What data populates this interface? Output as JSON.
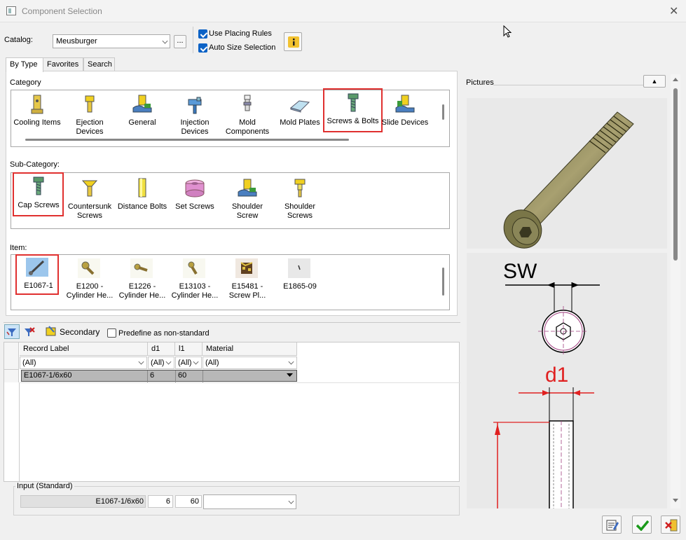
{
  "window": {
    "title": "Component Selection",
    "close_glyph": "✕"
  },
  "catalog": {
    "label": "Catalog:",
    "value": "Meusburger",
    "browse_label": "..."
  },
  "options": {
    "use_placing_rules": {
      "label": "Use Placing Rules",
      "checked": true
    },
    "auto_size_selection": {
      "label": "Auto Size Selection",
      "checked": true
    },
    "info_label": "i"
  },
  "tabs": [
    {
      "label": "By Type",
      "active": true
    },
    {
      "label": "Favorites",
      "active": false
    },
    {
      "label": "Search",
      "active": false
    }
  ],
  "category": {
    "label": "Category",
    "items": [
      {
        "label": "Cooling Items",
        "icon": "cooling-items-icon"
      },
      {
        "label": "Ejection Devices",
        "icon": "ejection-devices-icon"
      },
      {
        "label": "General",
        "icon": "general-icon"
      },
      {
        "label": "Injection Devices",
        "icon": "injection-devices-icon"
      },
      {
        "label": "Mold Components",
        "icon": "mold-components-icon"
      },
      {
        "label": "Mold Plates",
        "icon": "mold-plates-icon"
      },
      {
        "label": "Screws & Bolts",
        "icon": "screws-bolts-icon",
        "selected": true
      },
      {
        "label": "Slide Devices",
        "icon": "slide-devices-icon"
      }
    ]
  },
  "sub_category": {
    "label": "Sub-Category:",
    "items": [
      {
        "label": "Cap Screws",
        "icon": "cap-screws-icon",
        "selected": true
      },
      {
        "label": "Countersunk Screws",
        "icon": "countersunk-screws-icon"
      },
      {
        "label": "Distance Bolts",
        "icon": "distance-bolts-icon"
      },
      {
        "label": "Set Screws",
        "icon": "set-screws-icon"
      },
      {
        "label": "Shoulder Screw",
        "icon": "shoulder-screw-icon"
      },
      {
        "label": "Shoulder Screws",
        "icon": "shoulder-screws-icon"
      }
    ]
  },
  "item": {
    "label": "Item:",
    "items": [
      {
        "label": "E1067-1",
        "icon": "e1067-1-thumbnail",
        "selected": true
      },
      {
        "label": "E1200 - Cylinder He...",
        "icon": "e1200-thumbnail"
      },
      {
        "label": "E1226 - Cylinder He...",
        "icon": "e1226-thumbnail"
      },
      {
        "label": "E13103 - Cylinder He...",
        "icon": "e13103-thumbnail"
      },
      {
        "label": "E15481 - Screw Pl...",
        "icon": "e15481-thumbnail"
      },
      {
        "label": "E1865-09",
        "icon": "e1865-09-thumbnail"
      }
    ]
  },
  "toolbar": {
    "secondary_label": "Secondary",
    "predefine_label": "Predefine as non-standard",
    "predefine_checked": false
  },
  "grid": {
    "columns": [
      "Record Label",
      "d1",
      "l1",
      "Material"
    ],
    "filters": [
      "(All)",
      "(All)",
      "(All)",
      "(All)"
    ],
    "rows": [
      {
        "record_label": "E1067-1/6x60",
        "d1": "6",
        "l1": "60",
        "material": ""
      }
    ]
  },
  "input": {
    "label": "Input (Standard)",
    "record_label": "E1067-1/6x60",
    "d1": "6",
    "l1": "60",
    "material": ""
  },
  "pictures": {
    "label": "Pictures",
    "collapse_glyph": "▲",
    "dim_sw": "SW",
    "dim_d1": "d1"
  },
  "colors": {
    "accent": "#0b62c6",
    "highlight": "#e0302f",
    "dimension": "#e02020"
  }
}
